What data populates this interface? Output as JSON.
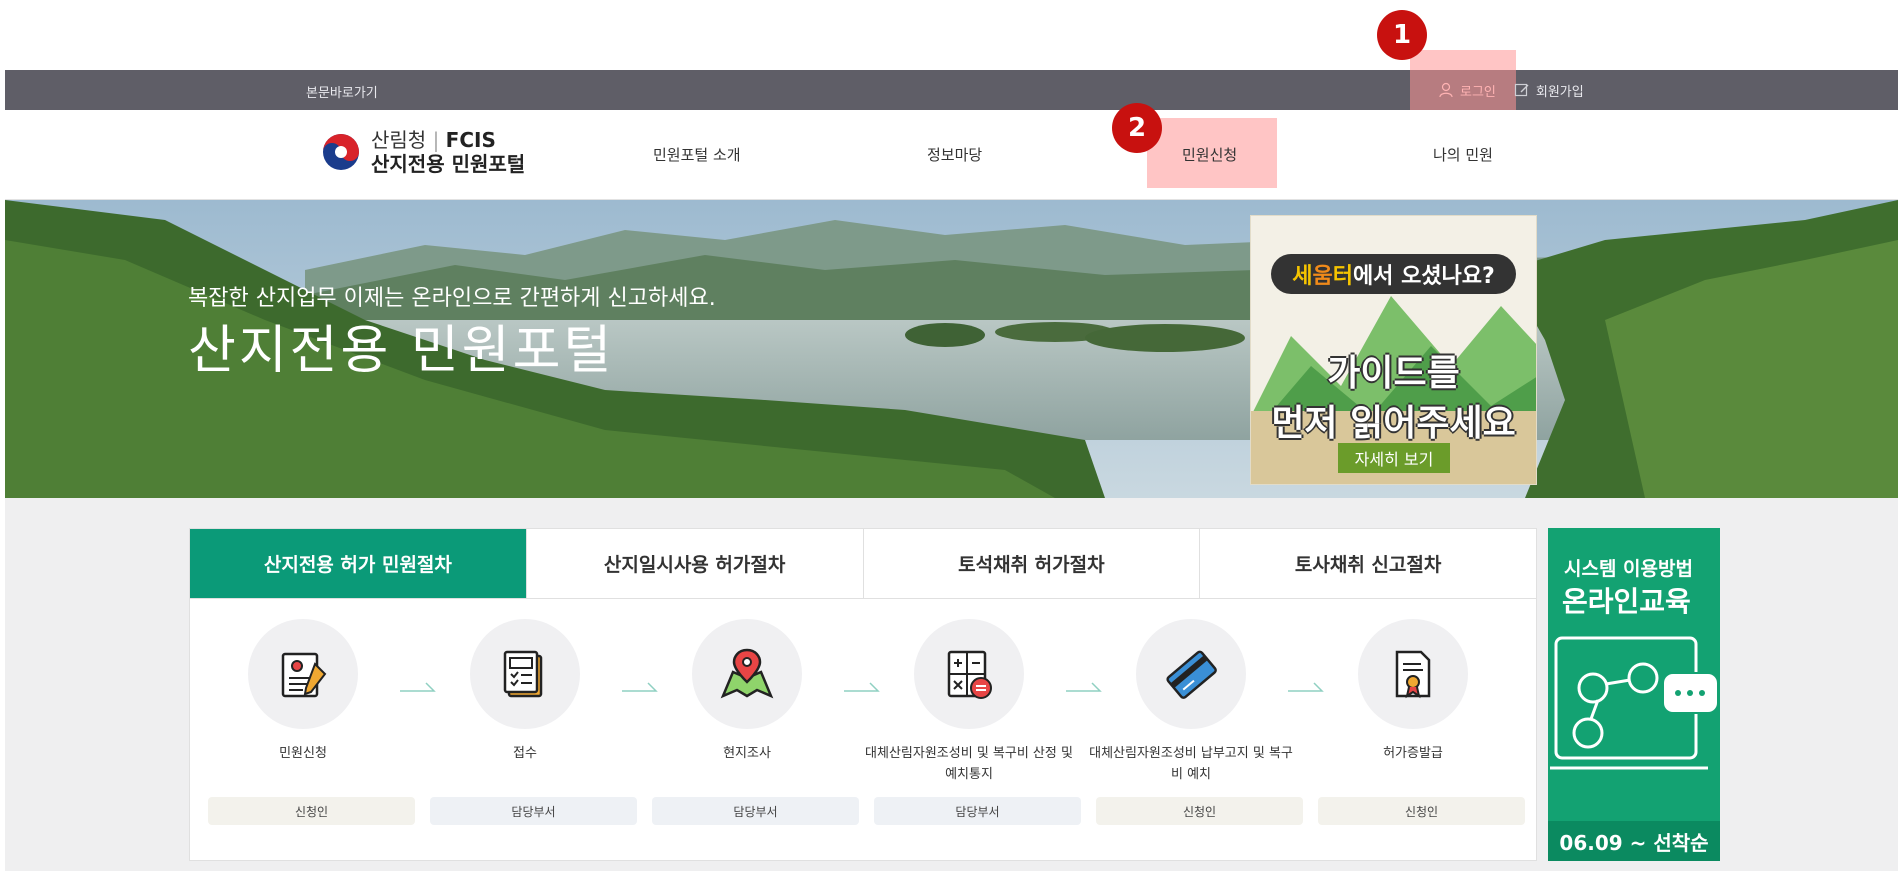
{
  "utility": {
    "skip_link": "본문바로가기",
    "login": "로그인",
    "signup": "회원가입"
  },
  "badges": {
    "one": "1",
    "two": "2"
  },
  "logo": {
    "org": "산림청",
    "code": "FCIS",
    "portal": "산지전용 민원포털"
  },
  "nav": {
    "items": [
      {
        "label": "민원포털 소개"
      },
      {
        "label": "정보마당"
      },
      {
        "label": "민원신청"
      },
      {
        "label": "나의 민원"
      }
    ]
  },
  "hero": {
    "subtitle": "복잡한 산지업무 이제는 온라인으로 간편하게 신고하세요.",
    "title": "산지전용 민원포털"
  },
  "promo": {
    "question_p1": "세",
    "question_p2": "움",
    "question_p3": "터",
    "question_rest": "에서 오셨나요?",
    "line1": "가이드를",
    "line2": "먼저 읽어주세요",
    "button": "자세히 보기"
  },
  "tabs": [
    {
      "label": "산지전용 허가 민원절차",
      "active": true
    },
    {
      "label": "산지일시사용 허가절차"
    },
    {
      "label": "토석채취 허가절차"
    },
    {
      "label": "토사채취 신고절차"
    }
  ],
  "steps": [
    {
      "label": "민원신청",
      "role": "신청인",
      "icon": "document-pen-icon"
    },
    {
      "label": "접수",
      "role": "담당부서",
      "icon": "checklist-icon"
    },
    {
      "label": "현지조사",
      "role": "담당부서",
      "icon": "map-pin-icon"
    },
    {
      "label": "대체산림자원조성비 및 복구비 산정 및 예치통지",
      "role": "담당부서",
      "icon": "calculator-icon"
    },
    {
      "label": "대체산림자원조성비 납부고지 및 복구비 예치",
      "role": "신청인",
      "icon": "credit-card-icon"
    },
    {
      "label": "허가증발급",
      "role": "신청인",
      "icon": "certificate-icon"
    }
  ],
  "edu": {
    "line1": "시스템 이용방법",
    "line2": "온라인교육",
    "date": "06.09 ~ 선착순"
  },
  "colors": {
    "utility_bar": "#5f5e67",
    "accent_green": "#0b9a78",
    "badge_red": "#c8110f",
    "highlight": "#ff9696"
  }
}
